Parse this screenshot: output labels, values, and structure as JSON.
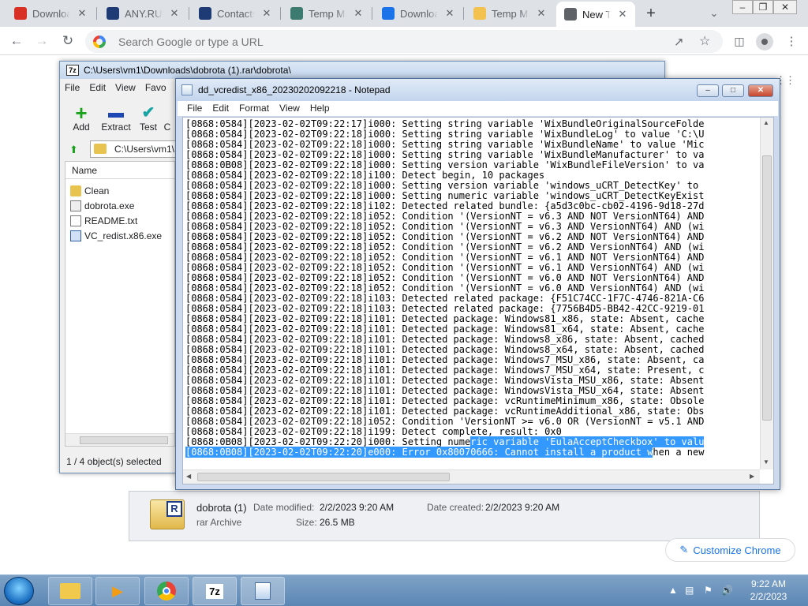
{
  "chrome": {
    "tabs": [
      {
        "title": "Downloa",
        "icon": "gmail-icon",
        "color": "#d93025"
      },
      {
        "title": "ANY.RUN",
        "icon": "anyrun-icon",
        "color": "#1f3b75"
      },
      {
        "title": "Contacts",
        "icon": "contacts-icon",
        "color": "#1f3b75"
      },
      {
        "title": "Temp Ma",
        "icon": "temp-mail-icon",
        "color": "#3d7a6f"
      },
      {
        "title": "Downloa",
        "icon": "download-icon",
        "color": "#1a73e8"
      },
      {
        "title": "Temp Ma",
        "icon": "temp-mail-envelope-icon",
        "color": "#f2c14e"
      },
      {
        "title": "New Tab",
        "icon": "chrome-icon",
        "color": "#5f6368"
      }
    ],
    "omnibox_placeholder": "Search Google or type a URL",
    "customize_label": "Customize Chrome"
  },
  "zip": {
    "title": "C:\\Users\\vm1\\Downloads\\dobrota (1).rar\\dobrota\\",
    "menu": [
      "File",
      "Edit",
      "View",
      "Favo"
    ],
    "toolbar": [
      {
        "label": "Add",
        "icon": "add-icon",
        "glyph": "+",
        "color": "#1aa31a"
      },
      {
        "label": "Extract",
        "icon": "extract-icon",
        "glyph": "—",
        "color": "#1d47b5"
      },
      {
        "label": "Test",
        "icon": "test-icon",
        "glyph": "✔",
        "color": "#1aa3a3"
      },
      {
        "label": "C",
        "icon": "copy-icon",
        "glyph": "",
        "color": "#333"
      }
    ],
    "path": "C:\\Users\\vm1\\D",
    "column_name": "Name",
    "files": [
      {
        "name": "Clean",
        "icon": "folder-icon"
      },
      {
        "name": "dobrota.exe",
        "icon": "exe-icon"
      },
      {
        "name": "README.txt",
        "icon": "text-file-icon"
      },
      {
        "name": "VC_redist.x86.exe",
        "icon": "installer-icon"
      }
    ],
    "status": "1 / 4 object(s) selected"
  },
  "file_info": {
    "name": "dobrota (1)",
    "type": "rar Archive",
    "date_modified_label": "Date modified:",
    "date_modified": "2/2/2023 9:20 AM",
    "size_label": "Size:",
    "size": "26.5 MB",
    "date_created_label": "Date created:",
    "date_created": "2/2/2023 9:20 AM"
  },
  "notepad": {
    "title": "dd_vcredist_x86_20230202092218 - Notepad",
    "menu": [
      "File",
      "Edit",
      "Format",
      "View",
      "Help"
    ],
    "lines": [
      "[0868:0584][2023-02-02T09:22:17]i000: Setting string variable 'WixBundleOriginalSourceFolde",
      "[0868:0584][2023-02-02T09:22:18]i000: Setting string variable 'WixBundleLog' to value 'C:\\U",
      "[0868:0584][2023-02-02T09:22:18]i000: Setting string variable 'WixBundleName' to value 'Mic",
      "[0868:0584][2023-02-02T09:22:18]i000: Setting string variable 'WixBundleManufacturer' to va",
      "[0868:0B08][2023-02-02T09:22:18]i000: Setting version variable 'WixBundleFileVersion' to va",
      "[0868:0584][2023-02-02T09:22:18]i100: Detect begin, 10 packages",
      "[0868:0584][2023-02-02T09:22:18]i000: Setting version variable 'windows_uCRT_DetectKey' to",
      "[0868:0584][2023-02-02T09:22:18]i000: Setting numeric variable 'windows_uCRT_DetectKeyExist",
      "[0868:0584][2023-02-02T09:22:18]i102: Detected related bundle: {a5d3c0bc-cb02-4196-9d18-27d",
      "[0868:0584][2023-02-02T09:22:18]i052: Condition '(VersionNT = v6.3 AND NOT VersionNT64) AND",
      "[0868:0584][2023-02-02T09:22:18]i052: Condition '(VersionNT = v6.3 AND VersionNT64) AND (wi",
      "[0868:0584][2023-02-02T09:22:18]i052: Condition '(VersionNT = v6.2 AND NOT VersionNT64) AND",
      "[0868:0584][2023-02-02T09:22:18]i052: Condition '(VersionNT = v6.2 AND VersionNT64) AND (wi",
      "[0868:0584][2023-02-02T09:22:18]i052: Condition '(VersionNT = v6.1 AND NOT VersionNT64) AND",
      "[0868:0584][2023-02-02T09:22:18]i052: Condition '(VersionNT = v6.1 AND VersionNT64) AND (wi",
      "[0868:0584][2023-02-02T09:22:18]i052: Condition '(VersionNT = v6.0 AND NOT VersionNT64) AND",
      "[0868:0584][2023-02-02T09:22:18]i052: Condition '(VersionNT = v6.0 AND VersionNT64) AND (wi",
      "[0868:0584][2023-02-02T09:22:18]i103: Detected related package: {F51C74CC-1F7C-4746-821A-C6",
      "[0868:0584][2023-02-02T09:22:18]i103: Detected related package: {7756B4D5-BB42-42CC-9219-01",
      "[0868:0584][2023-02-02T09:22:18]i101: Detected package: Windows81_x86, state: Absent, cache",
      "[0868:0584][2023-02-02T09:22:18]i101: Detected package: Windows81_x64, state: Absent, cache",
      "[0868:0584][2023-02-02T09:22:18]i101: Detected package: Windows8_x86, state: Absent, cached",
      "[0868:0584][2023-02-02T09:22:18]i101: Detected package: Windows8_x64, state: Absent, cached",
      "[0868:0584][2023-02-02T09:22:18]i101: Detected package: Windows7_MSU_x86, state: Absent, ca",
      "[0868:0584][2023-02-02T09:22:18]i101: Detected package: Windows7_MSU_x64, state: Present, c",
      "[0868:0584][2023-02-02T09:22:18]i101: Detected package: WindowsVista_MSU_x86, state: Absent",
      "[0868:0584][2023-02-02T09:22:18]i101: Detected package: WindowsVista_MSU_x64, state: Absent",
      "[0868:0584][2023-02-02T09:22:18]i101: Detected package: vcRuntimeMinimum_x86, state: Obsole",
      "[0868:0584][2023-02-02T09:22:18]i101: Detected package: vcRuntimeAdditional_x86, state: Obs",
      "[0868:0584][2023-02-02T09:22:18]i052: Condition 'VersionNT >= v6.0 OR (VersionNT = v5.1 AND",
      "[0868:0584][2023-02-02T09:22:18]i199: Detect complete, result: 0x0"
    ],
    "line_pre_hl": "[0868:0B08][2023-02-02T09:22:20]i000: Setting nume",
    "line_hl": "ric variable 'EulaAcceptCheckbox' to valu",
    "last_hl": "[0868:0B08][2023-02-02T09:22:20]e000: Error 0x80070666: Cannot install a product w",
    "last_rest": "hen a new"
  },
  "taskbar": {
    "time": "9:22 AM",
    "date": "2/2/2023",
    "apps": [
      "explorer-icon",
      "media-player-icon",
      "chrome-icon",
      "7zip-icon",
      "notepad-icon"
    ]
  }
}
